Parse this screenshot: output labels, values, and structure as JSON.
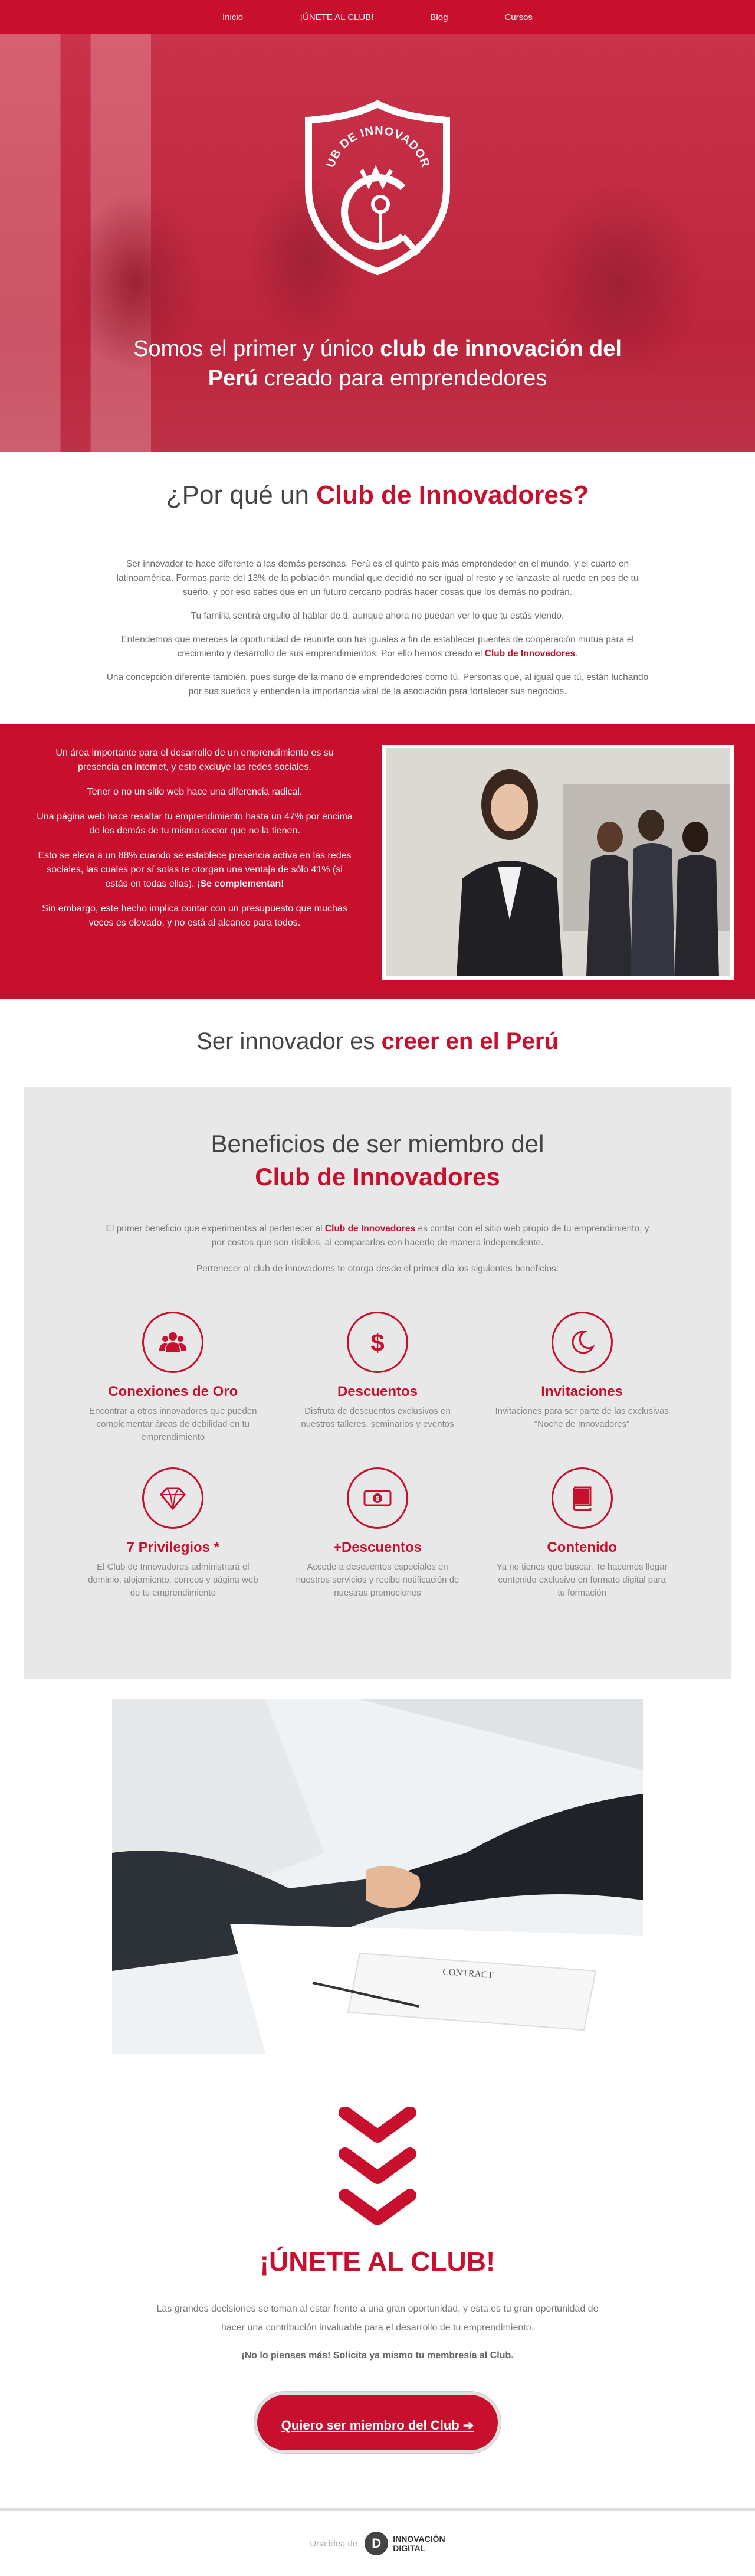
{
  "nav": {
    "items": [
      "Inicio",
      "¡ÚNETE AL CLUB!",
      "Blog",
      "Cursos"
    ]
  },
  "hero": {
    "logo_text": "CLUB DE INNOVADORES",
    "title_1": "Somos el primer y único ",
    "title_bold_1": "club de innovación del",
    "title_bold_2": "Perú",
    "title_2": " creado para emprendedores"
  },
  "why": {
    "title_plain": "¿Por qué un ",
    "title_bold": "Club de Innovadores?",
    "p1": "Ser innovador te hace diferente a las demás personas. Perú es el quinto país más emprendedor en el mundo, y el cuarto en latinoamérica. Formas parte del 13% de la población mundial que decidió no ser  igual al resto y te lanzaste al ruedo en pos de tu sueño, y  por eso sabes que en un futuro cercano podrás hacer cosas que los demás no podrán.",
    "p2": "Tu familia sentirá orgullo al hablar de ti, aunque ahora no puedan ver lo que tu estás viendo.",
    "p3": "Entendemos que mereces la oportunidad de reunirte con tus iguales a fin de establecer puentes de cooperación mutua para el crecimiento y desarrollo de sus emprendimientos. Por ello hemos creado el ",
    "p3_bold": "Club de Innovadores",
    "p3_end": ".",
    "p4": "Una concepción diferente también, pues surge de la mano de emprendedores como tú, Personas que, al igual que tú, están luchando por sus sueños y entienden la importancia vital de la asociación para fortalecer sus negocios."
  },
  "band": {
    "p1": "Un área importante para el desarrollo de un emprendimiento es su presencia en internet, y esto excluye las redes sociales.",
    "p2": "Tener o no un sitio web hace una diferencia radical.",
    "p3": "Una página web hace resaltar tu emprendimiento hasta un 47% por encima de los demás de tu mismo sector que no la tienen.",
    "p4": "Esto se eleva a un 88% cuando se establece presencia activa en las redes sociales, las cuales por sí solas te otorgan una ventaja de sólo 41% (si estás en todas ellas). ",
    "p4_bold": "¡Se complementan!",
    "p5": "Sin embargo, este hecho implica contar con un presupuesto que muchas veces es elevado, y no está al alcance para todos."
  },
  "innov": {
    "plain": "Ser innovador es ",
    "bold": "creer en el Perú"
  },
  "benefits": {
    "title_1": "Beneficios de ser miembro del",
    "title_2": "Club de Innovadores",
    "intro_1": "El primer beneficio que experimentas al pertenecer al ",
    "intro_1_bold": "Club de Innovadores",
    "intro_1_end": " es contar con el sitio web propio de tu emprendimiento, y por costos que son risibles, al compararlos con hacerlo de manera independiente.",
    "intro_2": "Pertenecer al club de innovadores te otorga desde el primer día los siguientes beneficios:",
    "items": [
      {
        "icon": "people-icon",
        "title": "Conexiones de Oro",
        "desc": "Encontrar a otros innovadores que pueden complementar áreas de debilidad en tu emprendimiento"
      },
      {
        "icon": "dollar-icon",
        "title": "Descuentos",
        "desc": "Disfruta de descuentos exclusivos en nuestros talleres, seminarios y eventos"
      },
      {
        "icon": "moon-icon",
        "title": "Invitaciones",
        "desc": "Invitaciones para ser parte de las exclusivas \"Noche de Innovadores\""
      },
      {
        "icon": "diamond-icon",
        "title": "7 Privilegios *",
        "desc": "El Club de Innovadores administrará el dominio, alojamiento, correos y página web de tu emprendimiento"
      },
      {
        "icon": "money-icon",
        "title": "+Descuentos",
        "desc": "Accede a descuentos especiales en nuestros servicios y recibe notificación de nuestras promociones"
      },
      {
        "icon": "book-icon",
        "title": "Contenido",
        "desc": "Ya no tienes que buscar. Te hacemos llegar contenido exclusivo en formato digital para tu formación"
      }
    ]
  },
  "join": {
    "title": "¡ÚNETE AL CLUB!",
    "p1": "Las grandes decisiones se toman al estar frente a una gran oportunidad, y esta es tu gran oportunidad de hacer una contribución invaluable para el desarrollo de tu emprendimiento.",
    "p2": "¡No lo pienses más! Solicita ya mismo tu membresía al Club.",
    "button": "Quiero ser miembro del Club ➔"
  },
  "footer": {
    "idea": "Una idea de",
    "brand_1": "INNOVACIÓN",
    "brand_2": "DIGITAL"
  },
  "colors": {
    "accent": "#c8102e"
  }
}
